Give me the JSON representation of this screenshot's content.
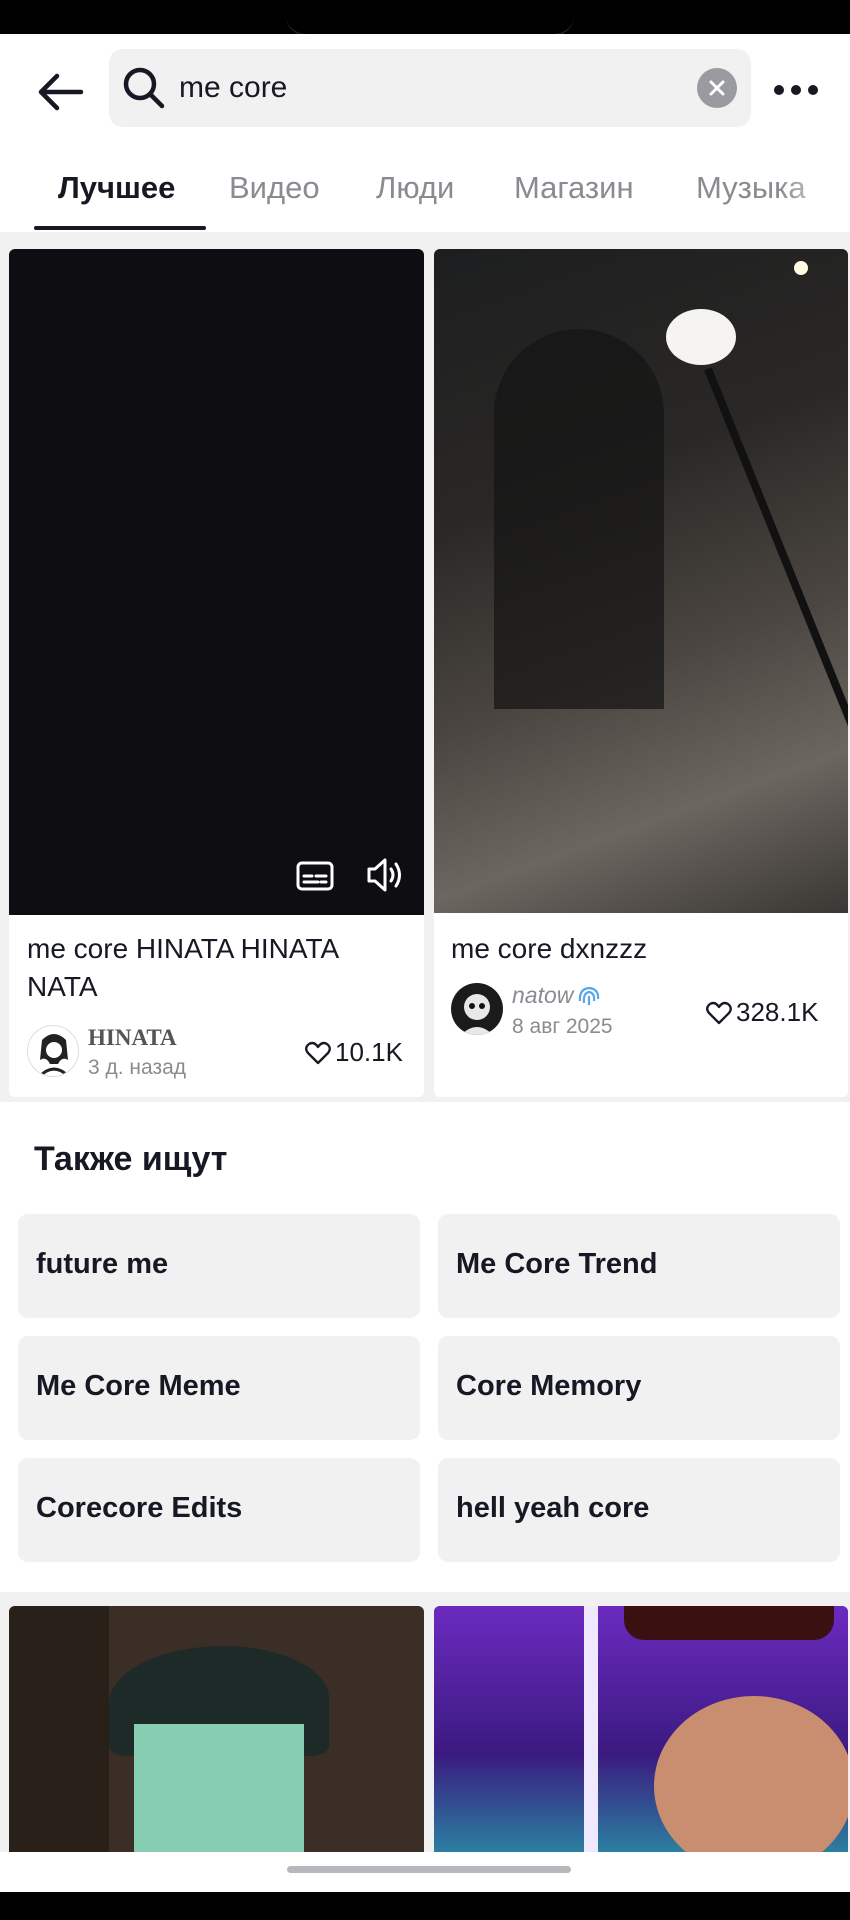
{
  "search": {
    "query": "me core",
    "back_icon": "arrow-left-icon",
    "search_icon": "search-icon",
    "clear_icon": "close-circle-icon",
    "more_icon": "more-dots-icon"
  },
  "tabs": [
    {
      "label": "Лучшее",
      "active": true
    },
    {
      "label": "Видео",
      "active": false
    },
    {
      "label": "Люди",
      "active": false
    },
    {
      "label": "Магазин",
      "active": false
    },
    {
      "label": "Музыка",
      "active": false
    }
  ],
  "videos": [
    {
      "title": "me core HINATA HINATA NATA",
      "author": "HINATA",
      "date": "3 д. назад",
      "likes": "10.1K",
      "overlay_icons": [
        "captions-icon",
        "volume-icon"
      ]
    },
    {
      "title": "me core dxnzzz",
      "author": "natow",
      "author_badge_icon": "fingerprint-emoji-icon",
      "date": "8 авг 2025",
      "likes": "328.1K"
    }
  ],
  "related": {
    "title": "Также ищут",
    "items": [
      "future me",
      "Me Core Trend",
      "Me Core Meme",
      "Core Memory",
      "Corecore Edits",
      "hell yeah core"
    ]
  },
  "colors": {
    "text_primary": "#161823",
    "text_secondary": "#8a8b91",
    "chip_bg": "#f1f1f2",
    "feed_bg": "#f1f1f2"
  }
}
